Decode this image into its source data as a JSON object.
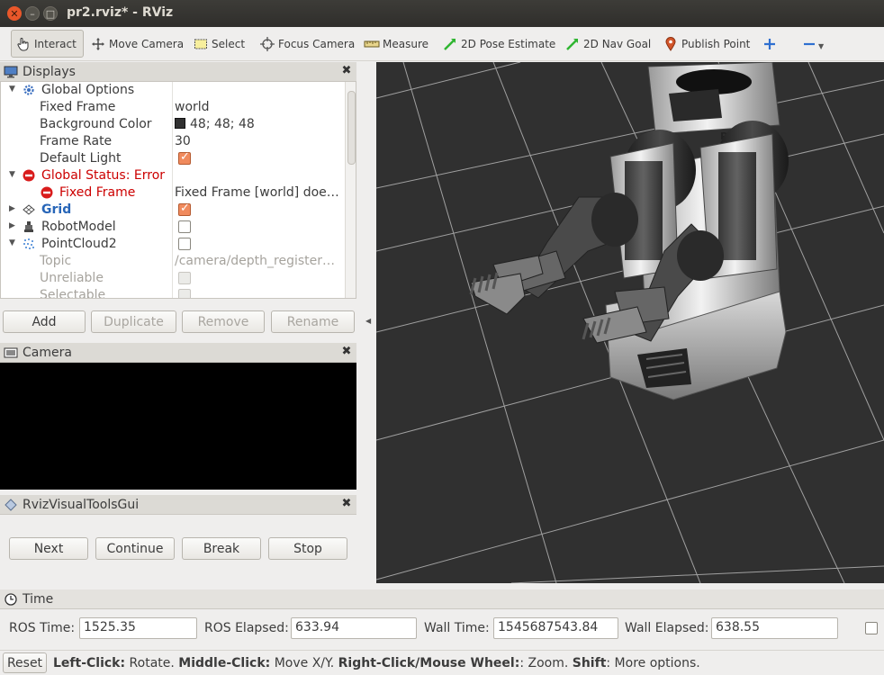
{
  "window": {
    "title": "pr2.rviz* - RViz"
  },
  "toolbar": {
    "interact": "Interact",
    "move_camera": "Move Camera",
    "select": "Select",
    "focus_camera": "Focus Camera",
    "measure": "Measure",
    "pose_estimate": "2D Pose Estimate",
    "nav_goal": "2D Nav Goal",
    "publish_point": "Publish Point",
    "accent_green": "#2fb531",
    "accent_blue": "#2f6fd0"
  },
  "displays": {
    "title": "Displays",
    "items": [
      {
        "label": "Global Options",
        "value": ""
      },
      {
        "label": "Fixed Frame",
        "value": "world"
      },
      {
        "label": "Background Color",
        "value": "48; 48; 48"
      },
      {
        "label": "Frame Rate",
        "value": "30"
      },
      {
        "label": "Default Light",
        "value": ""
      },
      {
        "label": "Global Status: Error",
        "value": ""
      },
      {
        "label": "Fixed Frame",
        "value": "Fixed Frame [world] doe…"
      },
      {
        "label": "Grid",
        "value": ""
      },
      {
        "label": "RobotModel",
        "value": ""
      },
      {
        "label": "PointCloud2",
        "value": ""
      },
      {
        "label": "Topic",
        "value": "/camera/depth_register…"
      },
      {
        "label": "Unreliable",
        "value": ""
      },
      {
        "label": "Selectable",
        "value": ""
      }
    ],
    "buttons": {
      "add": "Add",
      "duplicate": "Duplicate",
      "remove": "Remove",
      "rename": "Rename"
    },
    "background_color_hex": "#303030",
    "error_color": "#cc0000"
  },
  "camera": {
    "title": "Camera"
  },
  "rvt": {
    "title": "RvizVisualToolsGui",
    "next": "Next",
    "continue": "Continue",
    "break": "Break",
    "stop": "Stop"
  },
  "robot": {
    "label": "PR2"
  },
  "time": {
    "title": "Time",
    "ros_time_label": "ROS Time:",
    "ros_time": "1525.35",
    "ros_elapsed_label": "ROS Elapsed:",
    "ros_elapsed": "633.94",
    "wall_time_label": "Wall Time:",
    "wall_time": "1545687543.84",
    "wall_elapsed_label": "Wall Elapsed:",
    "wall_elapsed": "638.55"
  },
  "status": {
    "reset": "Reset",
    "left_click": "Left-Click:",
    "left_desc": " Rotate. ",
    "middle_click": "Middle-Click:",
    "middle_desc": " Move X/Y. ",
    "right_click": "Right-Click/Mouse Wheel:",
    "right_desc": ": Zoom. ",
    "shift": "Shift",
    "shift_desc": ": More options."
  }
}
